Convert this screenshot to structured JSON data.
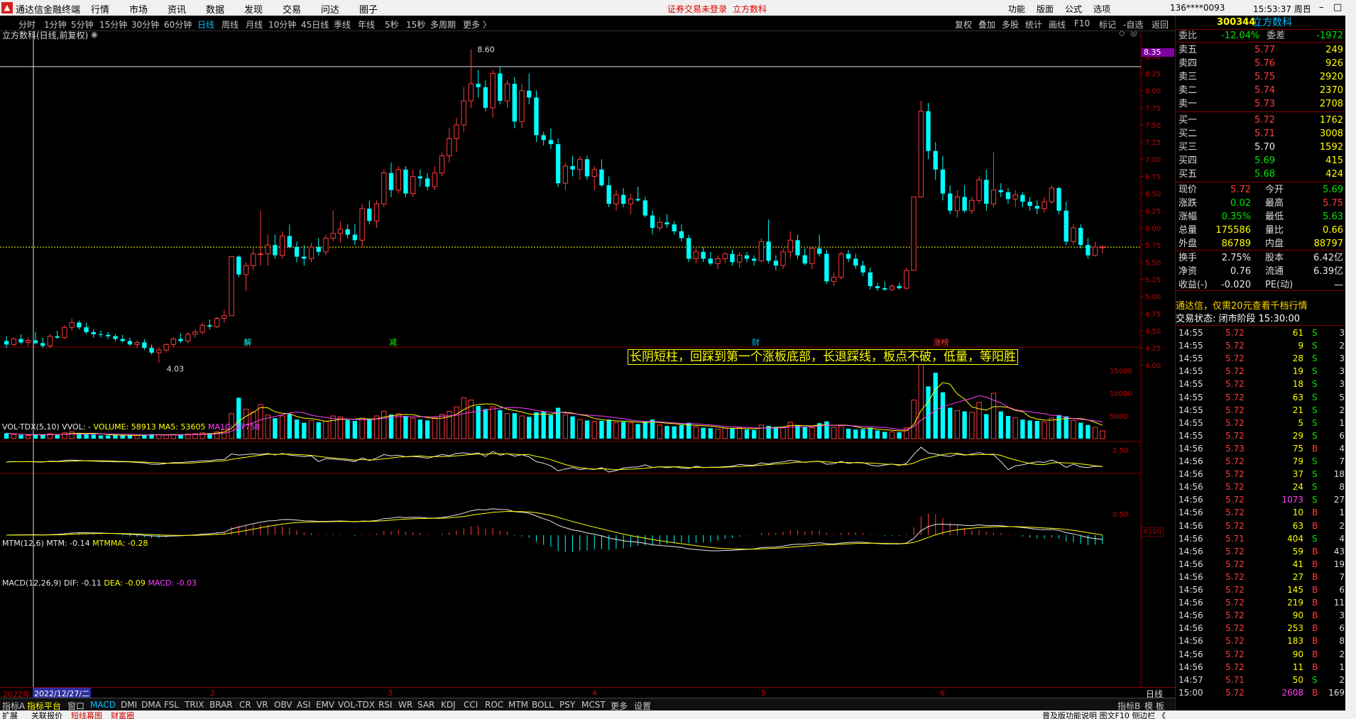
{
  "titlebar": {
    "app_name": "通达信金融终端",
    "menus": [
      "行情",
      "市场",
      "资讯",
      "数据",
      "发现",
      "交易",
      "问达",
      "圈子"
    ],
    "notice": "证券交易未登录",
    "stock_name": "立方数科",
    "right_items": [
      "功能",
      "版面",
      "公式",
      "选项"
    ],
    "account": "136****0093",
    "time": "15:53:37 周日"
  },
  "periods": [
    "分时",
    "1分钟",
    "5分钟",
    "15分钟",
    "30分钟",
    "60分钟",
    "日线",
    "周线",
    "月线",
    "10分钟",
    "45日线",
    "季线",
    "年线",
    "5秒",
    "15秒",
    "多周期",
    "更多 〉"
  ],
  "active_period": "日线",
  "chart_tools": [
    "复权",
    "叠加",
    "多股",
    "统计",
    "画线",
    "F10",
    "标记",
    "-自选",
    "返回"
  ],
  "chart_header": "立方数科(日线,前复权)",
  "annotation": "长阴短柱，回踩到第一个涨板底部，长退踩线，板点不破，低量，等阳胜",
  "price_panel": {
    "high_label": "8.60",
    "low_label": "4.03",
    "cursor_price": "8.35",
    "ticks": [
      "8.50",
      "8.25",
      "8.00",
      "7.75",
      "7.50",
      "7.25",
      "7.00",
      "6.75",
      "6.50",
      "6.25",
      "6.00",
      "5.75",
      "5.50",
      "5.25",
      "5.00",
      "4.75",
      "4.50",
      "4.25",
      "4.00"
    ],
    "markers": [
      "解",
      "减",
      "财",
      "涨榜"
    ]
  },
  "volume_panel": {
    "header": "VOL-TDX(5,10)  VVOL: -",
    "volume": "VOLUME: 58913",
    "ma5": "MA5: 53605",
    "ma10": "MA10: 57758",
    "ticks": [
      "15000",
      "10000",
      "5000"
    ],
    "unit": "X100"
  },
  "mtm_panel": {
    "header": "MTM(12,6)",
    "mtm": "MTM: -0.14",
    "mtmma": "MTMMA: -0.28",
    "tick": "2.50"
  },
  "macd_panel": {
    "header": "MACD(12,26,9)",
    "dif": "DIF: -0.11",
    "dea": "DEA: -0.09",
    "macd": "MACD: -0.03",
    "tick": "0.50"
  },
  "date_axis": {
    "year": "2022年",
    "cursor_date": "2022/12/27/二",
    "months": [
      "2",
      "3",
      "4",
      "5",
      "6"
    ],
    "mode": "日线"
  },
  "indicator_tabs": [
    "指标A",
    "指标平台",
    "窗口",
    "MACD",
    "DMI",
    "DMA",
    "FSL",
    "TRIX",
    "BRAR",
    "CR",
    "VR",
    "OBV",
    "ASI",
    "EMV",
    "VOL-TDX",
    "RSI",
    "WR",
    "SAR",
    "KDJ",
    "CCI",
    "ROC",
    "MTM",
    "BOLL",
    "PSY",
    "MCST",
    "更多",
    "设置"
  ],
  "active_indicator": "MACD",
  "indicator_right": [
    "指标B",
    "模 板"
  ],
  "statusbar": {
    "left": [
      "扩展",
      "关联报价",
      "短线幕图",
      "财富圈"
    ],
    "right": "普及版功能说明 图文F10 侧边栏 《"
  },
  "quote": {
    "code": "300344",
    "name": "立方数科",
    "weibi_label": "委比",
    "weibi": "-12.04%",
    "weicha_label": "委差",
    "weicha": "-1972",
    "asks": [
      [
        "卖五",
        "5.77",
        "249"
      ],
      [
        "卖四",
        "5.76",
        "926"
      ],
      [
        "卖三",
        "5.75",
        "2920"
      ],
      [
        "卖二",
        "5.74",
        "2370"
      ],
      [
        "卖一",
        "5.73",
        "2708"
      ]
    ],
    "bids": [
      [
        "买一",
        "5.72",
        "1762"
      ],
      [
        "买二",
        "5.71",
        "3008"
      ],
      [
        "买三",
        "5.70",
        "1592"
      ],
      [
        "买四",
        "5.69",
        "415"
      ],
      [
        "买五",
        "5.68",
        "424"
      ]
    ],
    "stats": [
      [
        "现价",
        "5.72",
        "今开",
        "5.69"
      ],
      [
        "涨跌",
        "0.02",
        "最高",
        "5.75"
      ],
      [
        "涨幅",
        "0.35%",
        "最低",
        "5.63"
      ],
      [
        "总量",
        "175586",
        "量比",
        "0.66"
      ],
      [
        "外盘",
        "86789",
        "内盘",
        "88797"
      ]
    ],
    "stats2": [
      [
        "换手",
        "2.75%",
        "股本",
        "6.42亿"
      ],
      [
        "净资",
        "0.76",
        "流通",
        "6.39亿"
      ],
      [
        "收益(-)",
        "-0.020",
        "PE(动)",
        "—"
      ]
    ],
    "ad": "通达信，仅需20元查看千档行情",
    "trade_state": "交易状态: 闭市阶段 15:30:00"
  },
  "ticks": [
    [
      "14:55",
      "5.72",
      "61",
      "S",
      "3"
    ],
    [
      "14:55",
      "5.72",
      "9",
      "S",
      "2"
    ],
    [
      "14:55",
      "5.72",
      "28",
      "S",
      "3"
    ],
    [
      "14:55",
      "5.72",
      "19",
      "S",
      "3"
    ],
    [
      "14:55",
      "5.72",
      "18",
      "S",
      "3"
    ],
    [
      "14:55",
      "5.72",
      "63",
      "S",
      "5"
    ],
    [
      "14:55",
      "5.72",
      "21",
      "S",
      "2"
    ],
    [
      "14:55",
      "5.72",
      "5",
      "S",
      "1"
    ],
    [
      "14:55",
      "5.72",
      "29",
      "S",
      "6"
    ],
    [
      "14:56",
      "5.73",
      "75",
      "B",
      "4"
    ],
    [
      "14:56",
      "5.72",
      "79",
      "S",
      "7"
    ],
    [
      "14:56",
      "5.72",
      "37",
      "S",
      "18"
    ],
    [
      "14:56",
      "5.72",
      "24",
      "S",
      "8"
    ],
    [
      "14:56",
      "5.72",
      "1073",
      "S",
      "27"
    ],
    [
      "14:56",
      "5.72",
      "10",
      "B",
      "1"
    ],
    [
      "14:56",
      "5.72",
      "63",
      "B",
      "2"
    ],
    [
      "14:56",
      "5.71",
      "404",
      "S",
      "4"
    ],
    [
      "14:56",
      "5.72",
      "59",
      "B",
      "43"
    ],
    [
      "14:56",
      "5.72",
      "41",
      "B",
      "19"
    ],
    [
      "14:56",
      "5.72",
      "27",
      "B",
      "7"
    ],
    [
      "14:56",
      "5.72",
      "145",
      "B",
      "6"
    ],
    [
      "14:56",
      "5.72",
      "219",
      "B",
      "11"
    ],
    [
      "14:56",
      "5.72",
      "90",
      "B",
      "3"
    ],
    [
      "14:56",
      "5.72",
      "253",
      "B",
      "6"
    ],
    [
      "14:56",
      "5.72",
      "183",
      "B",
      "8"
    ],
    [
      "14:56",
      "5.72",
      "90",
      "B",
      "2"
    ],
    [
      "14:56",
      "5.72",
      "11",
      "B",
      "1"
    ],
    [
      "14:57",
      "5.71",
      "50",
      "S",
      "2"
    ],
    [
      "15:00",
      "5.72",
      "2608",
      "B",
      "169"
    ]
  ],
  "chart_data": {
    "type": "candlestick",
    "ylim": [
      3.9,
      8.7
    ],
    "volume_ylim": [
      0,
      17500
    ],
    "candles": [
      [
        4.35,
        4.42,
        4.25,
        4.3,
        1200
      ],
      [
        4.3,
        4.4,
        4.28,
        4.38,
        900
      ],
      [
        4.38,
        4.45,
        4.3,
        4.33,
        800
      ],
      [
        4.33,
        4.4,
        4.28,
        4.36,
        700
      ],
      [
        4.36,
        4.48,
        4.3,
        4.32,
        850
      ],
      [
        4.32,
        4.4,
        4.25,
        4.28,
        900
      ],
      [
        4.28,
        4.45,
        4.25,
        4.42,
        1100
      ],
      [
        4.42,
        4.5,
        4.38,
        4.4,
        800
      ],
      [
        4.4,
        4.58,
        4.38,
        4.55,
        1300
      ],
      [
        4.55,
        4.68,
        4.5,
        4.62,
        1500
      ],
      [
        4.62,
        4.65,
        4.52,
        4.55,
        1200
      ],
      [
        4.55,
        4.62,
        4.45,
        4.48,
        1000
      ],
      [
        4.48,
        4.52,
        4.4,
        4.45,
        900
      ],
      [
        4.45,
        4.5,
        4.4,
        4.44,
        700
      ],
      [
        4.44,
        4.48,
        4.38,
        4.42,
        700
      ],
      [
        4.42,
        4.45,
        4.35,
        4.38,
        800
      ],
      [
        4.38,
        4.44,
        4.33,
        4.35,
        700
      ],
      [
        4.35,
        4.4,
        4.28,
        4.3,
        800
      ],
      [
        4.3,
        4.36,
        4.25,
        4.33,
        700
      ],
      [
        4.33,
        4.38,
        4.22,
        4.25,
        900
      ],
      [
        4.25,
        4.3,
        4.15,
        4.18,
        1000
      ],
      [
        4.18,
        4.25,
        4.03,
        4.22,
        900
      ],
      [
        4.22,
        4.32,
        4.18,
        4.3,
        800
      ],
      [
        4.3,
        4.4,
        4.26,
        4.38,
        900
      ],
      [
        4.38,
        4.46,
        4.32,
        4.35,
        800
      ],
      [
        4.35,
        4.48,
        4.32,
        4.45,
        1000
      ],
      [
        4.45,
        4.52,
        4.4,
        4.48,
        1100
      ],
      [
        4.48,
        4.62,
        4.45,
        4.58,
        1300
      ],
      [
        4.58,
        4.66,
        4.52,
        4.56,
        1200
      ],
      [
        4.56,
        4.7,
        4.54,
        4.68,
        1500
      ],
      [
        4.68,
        4.8,
        4.62,
        4.72,
        2000
      ],
      [
        4.72,
        5.58,
        4.72,
        5.58,
        5500
      ],
      [
        5.58,
        5.6,
        5.28,
        5.32,
        9000
      ],
      [
        5.32,
        5.5,
        5.08,
        5.45,
        6500
      ],
      [
        5.45,
        5.7,
        5.38,
        5.62,
        5800
      ],
      [
        5.62,
        6.25,
        5.45,
        5.62,
        7500
      ],
      [
        5.62,
        5.9,
        5.45,
        5.75,
        5200
      ],
      [
        5.75,
        5.9,
        5.55,
        5.6,
        4500
      ],
      [
        5.6,
        5.95,
        5.55,
        5.88,
        5000
      ],
      [
        5.88,
        6.05,
        5.7,
        5.72,
        5400
      ],
      [
        5.72,
        5.8,
        5.5,
        5.58,
        4200
      ],
      [
        5.58,
        5.75,
        5.45,
        5.55,
        3500
      ],
      [
        5.55,
        5.78,
        5.5,
        5.72,
        4000
      ],
      [
        5.72,
        5.85,
        5.6,
        5.65,
        3600
      ],
      [
        5.65,
        5.9,
        5.6,
        5.85,
        3800
      ],
      [
        5.85,
        6.25,
        5.8,
        5.92,
        5000
      ],
      [
        5.92,
        6.1,
        5.78,
        5.98,
        4800
      ],
      [
        5.98,
        6.05,
        5.85,
        5.9,
        4100
      ],
      [
        5.9,
        6.05,
        5.75,
        5.82,
        3900
      ],
      [
        5.82,
        6.35,
        5.72,
        6.28,
        4500
      ],
      [
        6.28,
        6.4,
        6.05,
        6.1,
        4300
      ],
      [
        6.1,
        6.4,
        6.0,
        6.35,
        5000
      ],
      [
        6.35,
        6.85,
        6.3,
        6.8,
        6000
      ],
      [
        6.8,
        6.95,
        6.45,
        6.55,
        5300
      ],
      [
        6.55,
        6.9,
        6.5,
        6.85,
        5500
      ],
      [
        6.85,
        6.9,
        6.45,
        6.5,
        5000
      ],
      [
        6.5,
        6.85,
        6.45,
        6.75,
        4500
      ],
      [
        6.75,
        6.85,
        6.6,
        6.72,
        4200
      ],
      [
        6.72,
        6.8,
        6.55,
        6.6,
        4000
      ],
      [
        6.6,
        6.9,
        6.55,
        6.8,
        4600
      ],
      [
        6.8,
        7.1,
        6.75,
        7.05,
        5300
      ],
      [
        7.05,
        7.45,
        6.95,
        7.3,
        6000
      ],
      [
        7.3,
        7.6,
        7.1,
        7.5,
        7000
      ],
      [
        7.5,
        8.05,
        7.4,
        7.85,
        9000
      ],
      [
        7.85,
        8.6,
        7.75,
        8.1,
        8500
      ],
      [
        8.1,
        8.3,
        7.9,
        8.05,
        7200
      ],
      [
        8.05,
        8.15,
        7.7,
        7.75,
        6500
      ],
      [
        7.75,
        8.3,
        7.6,
        8.25,
        7000
      ],
      [
        8.25,
        8.35,
        7.8,
        7.85,
        6300
      ],
      [
        7.85,
        8.15,
        7.75,
        8.1,
        5500
      ],
      [
        8.1,
        8.2,
        7.45,
        7.55,
        5600
      ],
      [
        7.55,
        8.1,
        7.45,
        8.0,
        5000
      ],
      [
        8.0,
        8.25,
        7.8,
        7.9,
        4800
      ],
      [
        7.9,
        8.0,
        7.25,
        7.35,
        5800
      ],
      [
        7.35,
        7.4,
        7.2,
        7.28,
        6000
      ],
      [
        7.28,
        7.45,
        7.15,
        7.22,
        5200
      ],
      [
        7.22,
        7.3,
        6.6,
        6.65,
        6800
      ],
      [
        6.65,
        6.95,
        6.55,
        6.9,
        5200
      ],
      [
        6.9,
        7.05,
        6.75,
        6.85,
        4900
      ],
      [
        6.85,
        7.05,
        6.7,
        7.0,
        4200
      ],
      [
        7.0,
        7.05,
        6.7,
        6.75,
        4000
      ],
      [
        6.75,
        6.9,
        6.55,
        6.85,
        3800
      ],
      [
        6.85,
        7.0,
        6.6,
        6.62,
        3900
      ],
      [
        6.62,
        6.75,
        6.3,
        6.35,
        4200
      ],
      [
        6.35,
        6.55,
        6.25,
        6.48,
        3600
      ],
      [
        6.48,
        6.58,
        6.3,
        6.35,
        3700
      ],
      [
        6.35,
        6.5,
        6.2,
        6.42,
        3500
      ],
      [
        6.42,
        6.6,
        6.38,
        6.4,
        3200
      ],
      [
        6.4,
        6.45,
        6.15,
        6.18,
        3800
      ],
      [
        6.18,
        6.25,
        5.9,
        6.0,
        4200
      ],
      [
        6.0,
        6.15,
        5.95,
        6.08,
        3000
      ],
      [
        6.08,
        6.2,
        6.0,
        6.05,
        2800
      ],
      [
        6.05,
        6.1,
        5.9,
        5.95,
        2700
      ],
      [
        5.95,
        6.05,
        5.8,
        5.85,
        3000
      ],
      [
        5.85,
        5.9,
        5.5,
        5.55,
        3500
      ],
      [
        5.55,
        5.7,
        5.48,
        5.65,
        2600
      ],
      [
        5.65,
        5.72,
        5.5,
        5.55,
        2400
      ],
      [
        5.55,
        5.65,
        5.45,
        5.48,
        2300
      ],
      [
        5.48,
        5.6,
        5.4,
        5.55,
        2100
      ],
      [
        5.55,
        5.65,
        5.48,
        5.62,
        2300
      ],
      [
        5.62,
        5.68,
        5.45,
        5.5,
        2200
      ],
      [
        5.5,
        5.65,
        5.42,
        5.6,
        2400
      ],
      [
        5.6,
        5.65,
        5.5,
        5.55,
        2000
      ],
      [
        5.55,
        5.6,
        5.45,
        5.52,
        1900
      ],
      [
        5.52,
        5.85,
        5.5,
        5.8,
        3000
      ],
      [
        5.8,
        6.12,
        5.48,
        5.52,
        2800
      ],
      [
        5.52,
        5.6,
        5.38,
        5.45,
        2600
      ],
      [
        5.45,
        5.7,
        5.4,
        5.65,
        2500
      ],
      [
        5.65,
        5.95,
        5.55,
        5.82,
        3600
      ],
      [
        5.82,
        5.9,
        5.55,
        5.6,
        3000
      ],
      [
        5.6,
        5.7,
        5.45,
        5.48,
        2500
      ],
      [
        5.48,
        5.72,
        5.4,
        5.7,
        2400
      ],
      [
        5.7,
        5.9,
        5.58,
        5.62,
        3400
      ],
      [
        5.62,
        5.68,
        5.18,
        5.22,
        3800
      ],
      [
        5.22,
        5.35,
        5.15,
        5.28,
        2500
      ],
      [
        5.28,
        5.65,
        5.25,
        5.62,
        2800
      ],
      [
        5.62,
        5.68,
        5.5,
        5.55,
        2200
      ],
      [
        5.55,
        5.62,
        5.4,
        5.45,
        2000
      ],
      [
        5.45,
        5.52,
        5.3,
        5.35,
        2100
      ],
      [
        5.35,
        5.42,
        5.1,
        5.15,
        2400
      ],
      [
        5.15,
        5.2,
        5.08,
        5.12,
        1800
      ],
      [
        5.12,
        5.22,
        5.08,
        5.1,
        1500
      ],
      [
        5.1,
        5.18,
        5.08,
        5.15,
        1500
      ],
      [
        5.15,
        5.2,
        5.1,
        5.12,
        1400
      ],
      [
        5.12,
        5.42,
        5.1,
        5.38,
        2400
      ],
      [
        5.38,
        6.45,
        5.6,
        6.45,
        8500
      ],
      [
        6.45,
        7.85,
        6.45,
        7.7,
        17000
      ],
      [
        7.7,
        7.82,
        7.0,
        7.12,
        11500
      ],
      [
        7.12,
        7.25,
        6.7,
        6.85,
        14500
      ],
      [
        6.85,
        7.05,
        6.4,
        6.5,
        10200
      ],
      [
        6.5,
        6.62,
        6.2,
        6.25,
        6800
      ],
      [
        6.25,
        6.55,
        6.15,
        6.45,
        6200
      ],
      [
        6.45,
        6.62,
        6.22,
        6.25,
        6000
      ],
      [
        6.25,
        6.45,
        6.2,
        6.4,
        5800
      ],
      [
        6.4,
        6.75,
        6.35,
        6.7,
        8000
      ],
      [
        6.7,
        6.85,
        6.25,
        6.35,
        5400
      ],
      [
        6.35,
        7.1,
        6.3,
        6.55,
        10000
      ],
      [
        6.55,
        6.65,
        6.45,
        6.52,
        6000
      ],
      [
        6.52,
        6.58,
        6.35,
        6.42,
        5000
      ],
      [
        6.42,
        6.55,
        6.3,
        6.48,
        4600
      ],
      [
        6.48,
        6.52,
        6.3,
        6.38,
        4200
      ],
      [
        6.38,
        6.45,
        6.25,
        6.32,
        4000
      ],
      [
        6.32,
        6.4,
        6.2,
        6.28,
        3900
      ],
      [
        6.28,
        6.45,
        6.22,
        6.38,
        3700
      ],
      [
        6.38,
        6.62,
        6.35,
        6.58,
        4500
      ],
      [
        6.58,
        6.6,
        6.2,
        6.25,
        5200
      ],
      [
        6.25,
        6.38,
        5.75,
        5.8,
        4900
      ],
      [
        5.8,
        6.05,
        5.75,
        6.0,
        4000
      ],
      [
        6.0,
        6.05,
        5.7,
        5.75,
        3500
      ],
      [
        5.75,
        5.85,
        5.55,
        5.6,
        3000
      ],
      [
        5.6,
        5.8,
        5.58,
        5.72,
        2500
      ],
      [
        5.72,
        5.75,
        5.63,
        5.72,
        1700
      ]
    ]
  }
}
